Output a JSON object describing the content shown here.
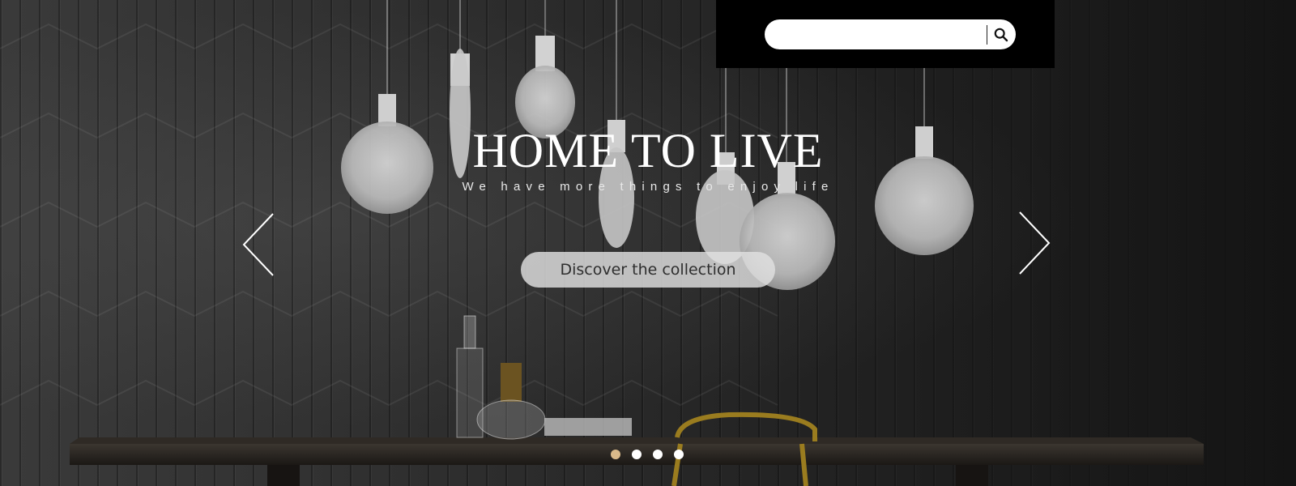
{
  "search": {
    "value": "",
    "placeholder": "",
    "button_icon": "search-icon"
  },
  "hero": {
    "title": "HOME TO LIVE",
    "subtitle": "We have more things to enjoy life",
    "cta_label": "Discover the collection",
    "prev_icon": "chevron-left-icon",
    "next_icon": "chevron-right-icon"
  },
  "carousel": {
    "slide_count": 4,
    "active_index": 0,
    "active_color": "#d9b98a",
    "inactive_color": "#ffffff"
  },
  "colors": {
    "search_bg": "#000000",
    "text": "#ffffff"
  }
}
